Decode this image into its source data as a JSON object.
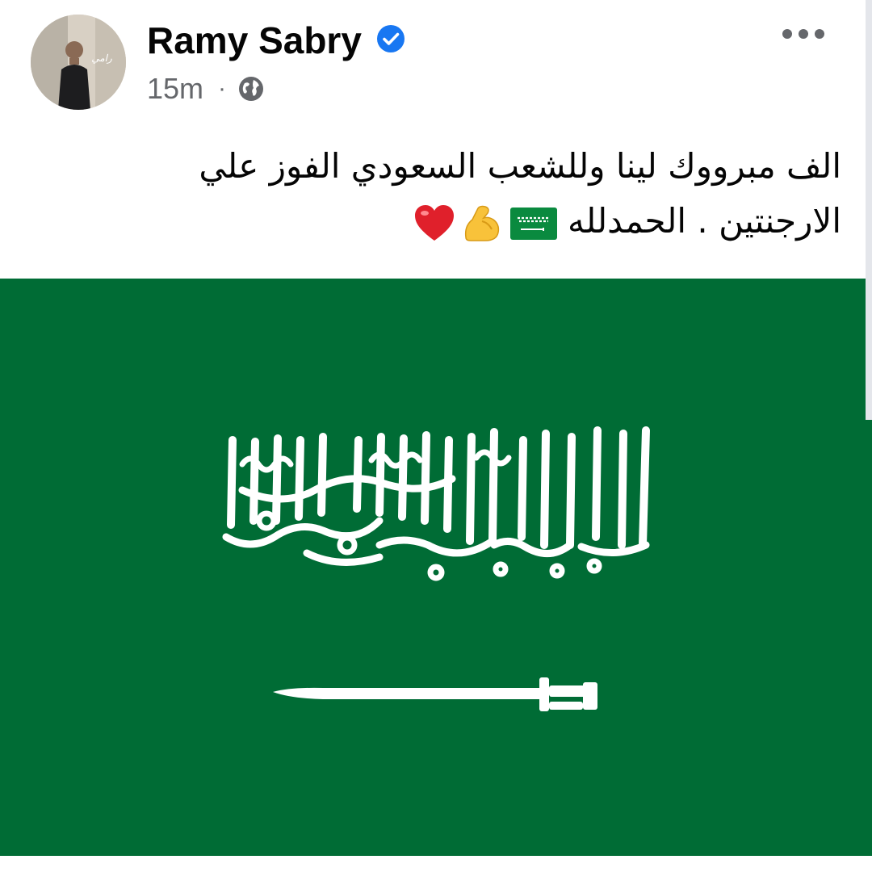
{
  "post": {
    "author": {
      "name": "Ramy Sabry",
      "verified": true,
      "avatar_text": "Ramy Sabry"
    },
    "meta": {
      "time": "15m",
      "separator": "·",
      "audience_icon": "globe-icon"
    },
    "more_icon": "more-options-icon",
    "text_lines": [
      "الف مبرووك لينا وللشعب السعودي الفوز علي",
      "الارجنتين . الحمدلله"
    ],
    "emojis": [
      "saudi-flag-emoji",
      "flexed-biceps-emoji",
      "red-heart-emoji"
    ],
    "image": {
      "subject": "saudi-flag",
      "calligraphy": "لا إله إلا الله محمد رسول الله"
    }
  },
  "colors": {
    "flag_green": "#006c35",
    "verified_blue": "#1877f2",
    "meta_gray": "#65676b",
    "text": "#050505"
  }
}
